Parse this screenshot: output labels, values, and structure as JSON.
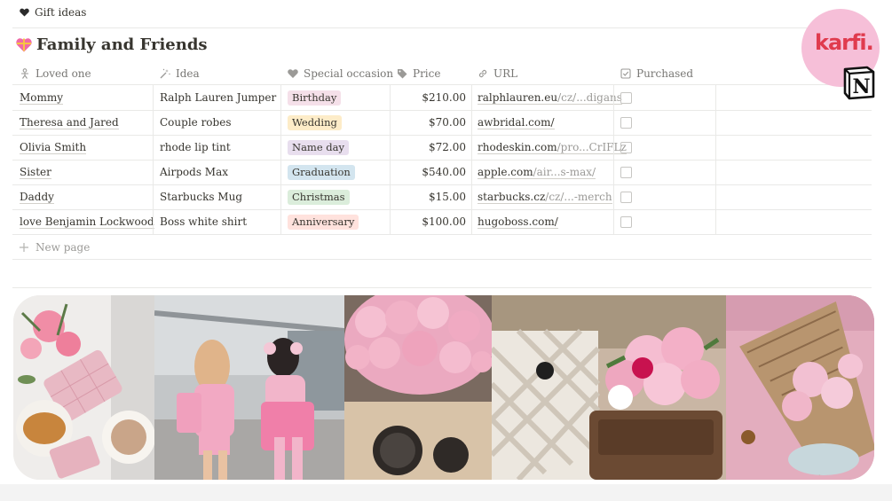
{
  "breadcrumb": {
    "label": "Gift ideas",
    "icon": "black-heart-icon"
  },
  "page": {
    "title": "Family and Friends",
    "title_icon": "gift-heart-icon"
  },
  "columns": [
    {
      "label": "Loved one",
      "icon": "person-icon"
    },
    {
      "label": "Idea",
      "icon": "magic-wand-icon"
    },
    {
      "label": "Special occasion",
      "icon": "heart-icon"
    },
    {
      "label": "Price",
      "icon": "tag-icon"
    },
    {
      "label": "URL",
      "icon": "link-icon"
    },
    {
      "label": "Purchased",
      "icon": "checkbox-icon"
    }
  ],
  "rows": [
    {
      "name": "Mommy",
      "idea": "Ralph Lauren Jumper",
      "occasion": "Birthday",
      "occasion_color": "#f5e0e9",
      "price": "$210.00",
      "url_host": "ralphlauren.eu",
      "url_path": "/cz/...digans",
      "purchased": false
    },
    {
      "name": "Theresa and Jared",
      "idea": "Couple robes",
      "occasion": "Wedding",
      "occasion_color": "#fdecc8",
      "price": "$70.00",
      "url_host": "awbridal.com/",
      "url_path": "",
      "purchased": false
    },
    {
      "name": "Olivia Smith",
      "idea": "rhode lip tint",
      "occasion": "Name day",
      "occasion_color": "#e8deee",
      "price": "$72.00",
      "url_host": "rhodeskin.com",
      "url_path": "/pro...CrIFLz",
      "purchased": false
    },
    {
      "name": "Sister",
      "idea": "Airpods Max",
      "occasion": "Graduation",
      "occasion_color": "#d3e5ef",
      "price": "$540.00",
      "url_host": "apple.com",
      "url_path": "/air...s-max/",
      "purchased": false
    },
    {
      "name": "Daddy",
      "idea": "Starbucks Mug",
      "occasion": "Christmas",
      "occasion_color": "#dbeddb",
      "price": "$15.00",
      "url_host": "starbucks.cz",
      "url_path": "/cz/...-merch",
      "purchased": false
    },
    {
      "name": "love Benjamin Lockwood",
      "idea": "Boss white shirt",
      "occasion": "Anniversary",
      "occasion_color": "#ffe2dd",
      "price": "$100.00",
      "url_host": "hugoboss.com/",
      "url_path": "",
      "purchased": false
    }
  ],
  "new_page_label": "New page",
  "branding": {
    "karfi_text": "karfi.",
    "notion_letter": "N"
  },
  "colors": {
    "accent_pink": "#f6bfd8",
    "karfi_red": "#e03b4e",
    "text": "#37352f",
    "muted": "#787774"
  },
  "gallery_photos": [
    "pink-flatlay-photo",
    "two-women-pink-outfits-photo",
    "pink-peonies-car-photo",
    "peonies-handbag-photo",
    "peonies-pink-car-photo"
  ]
}
